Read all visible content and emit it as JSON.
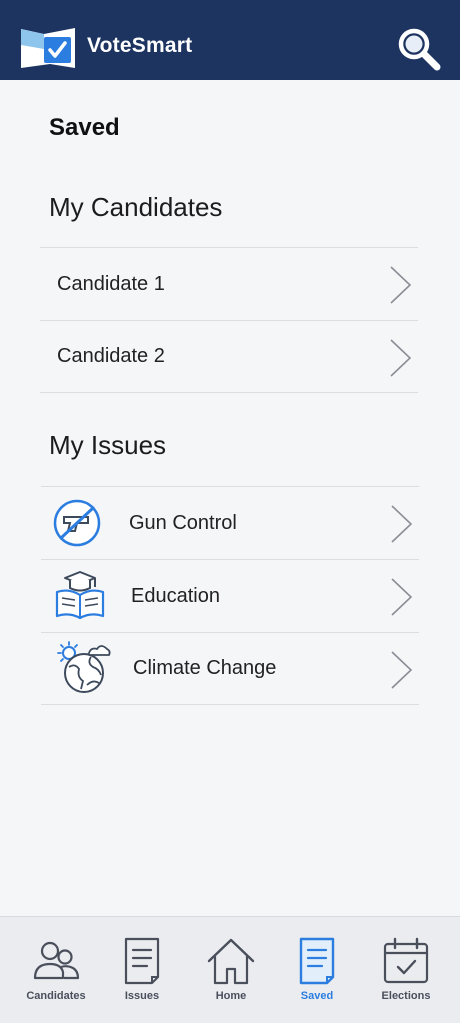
{
  "header": {
    "app_name": "VoteSmart",
    "logo_icon": "checkbox-map-icon",
    "search_icon": "search-icon"
  },
  "page": {
    "title": "Saved"
  },
  "candidates": {
    "section_title": "My Candidates",
    "items": [
      {
        "label": "Candidate 1"
      },
      {
        "label": "Candidate 2"
      }
    ]
  },
  "issues": {
    "section_title": "My Issues",
    "items": [
      {
        "label": "Gun Control",
        "icon": "no-gun-icon"
      },
      {
        "label": "Education",
        "icon": "graduation-book-icon"
      },
      {
        "label": "Climate Change",
        "icon": "globe-weather-icon"
      }
    ]
  },
  "tabbar": {
    "active": "Saved",
    "accent": "#2b7de0",
    "tabs": [
      {
        "label": "Candidates",
        "icon": "people-icon"
      },
      {
        "label": "Issues",
        "icon": "document-icon"
      },
      {
        "label": "Home",
        "icon": "house-icon"
      },
      {
        "label": "Saved",
        "icon": "saved-document-icon"
      },
      {
        "label": "Elections",
        "icon": "calendar-check-icon"
      }
    ]
  },
  "colors": {
    "header_bg": "#1d3461",
    "background": "#f5f6f8"
  }
}
